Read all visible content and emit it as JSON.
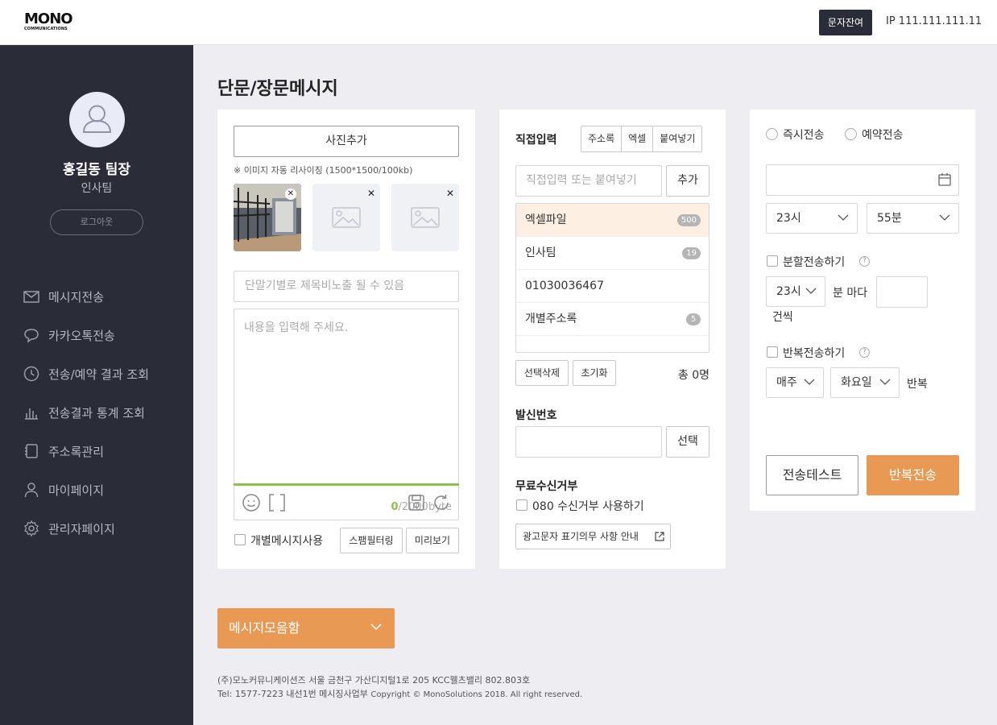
{
  "header": {
    "logo_main": "MONO",
    "logo_sub": "COMMUNICATIONS",
    "credit_button": "문자잔여",
    "ip_label": "IP 111.111.111.11"
  },
  "sidebar": {
    "user_name": "홍길동 팀장",
    "user_dept": "인사팀",
    "logout": "로그아웃",
    "items": [
      {
        "label": "메시지전송",
        "icon": "mail-icon"
      },
      {
        "label": "카카오톡전송",
        "icon": "chat-bubble-icon"
      },
      {
        "label": "전송/예약 결과 조회",
        "icon": "clock-icon"
      },
      {
        "label": "전송결과 통계 조회",
        "icon": "bar-chart-icon"
      },
      {
        "label": "주소록관리",
        "icon": "address-book-icon"
      },
      {
        "label": "마이페이지",
        "icon": "person-icon"
      },
      {
        "label": "관리자페이지",
        "icon": "gear-icon"
      }
    ]
  },
  "page_title": "단문/장문메시지",
  "composer": {
    "add_photo": "사진추가",
    "resize_note": "※ 이미지 자동 리사이징 (1500*1500/100kb)",
    "subject_placeholder": "단말기별로 제목비노출 될 수 있음",
    "content_placeholder": "내용을 입력해 주세요.",
    "byte_used": "0",
    "byte_limit": "/2000byte",
    "individual_message": "개별메시지사용",
    "spam_filter": "스팸필터링",
    "preview": "미리보기"
  },
  "recipients": {
    "direct_input_title": "직접입력",
    "tabs": [
      "주소록",
      "엑셀",
      "붙여넣기"
    ],
    "input_placeholder": "직접입력 또는 붙여넣기",
    "add_button": "추가",
    "list": [
      {
        "label": "엑셀파일",
        "count": "500"
      },
      {
        "label": "인사팀",
        "count": "19"
      },
      {
        "label": "01030036467",
        "count": ""
      },
      {
        "label": "개별주소록",
        "count": "5"
      }
    ],
    "delete_selected": "선택삭제",
    "reset": "초기화",
    "total": "총 0명",
    "sender_title": "발신번호",
    "select_button": "선택",
    "optout_title": "무료수신거부",
    "optout_080": "080 수신거부 사용하기",
    "ad_notice": "광고문자 표기의무 사항 안내"
  },
  "schedule": {
    "immediate": "즉시전송",
    "reserved": "예약전송",
    "hour": "23시",
    "minute": "55분",
    "split_send": "분할전송하기",
    "split_hour": "23시",
    "per_minutes": "분 마다",
    "per_count": "건씩",
    "repeat_send": "반복전송하기",
    "repeat_period": "매주",
    "repeat_day": "화요일",
    "repeat_label": "반복",
    "test_button": "전송테스트",
    "send_button": "반복전송"
  },
  "message_box": "메시지모음함",
  "footer": {
    "line1": "(주)모노커뮤니케이션즈 서울 금천구 가산디지털1로 205 KCC웰츠밸리 802.803호",
    "line2_a": "Tel: 1577-7223 내선1번 메시징사업부",
    "line2_b": "Copyright © MonoSolutions 2018. All right reserved."
  },
  "colors": {
    "sidebar_bg": "#2a2d38",
    "accent_orange": "#e89a55",
    "progress_green": "#8bc34a",
    "active_row": "#fdf0e3"
  }
}
